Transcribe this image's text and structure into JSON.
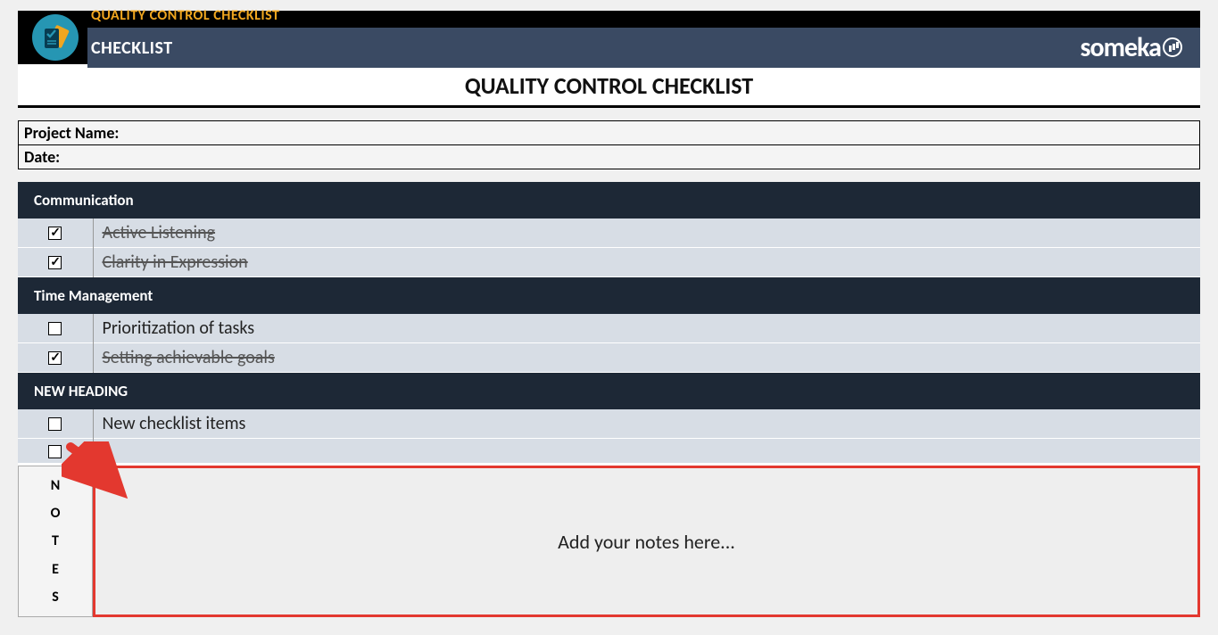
{
  "banner": {
    "title": "QUALITY CONTROL CHECKLIST",
    "subtitle": "CHECKLIST",
    "logo_text": "someka"
  },
  "main_title": "QUALITY CONTROL CHECKLIST",
  "meta": {
    "project_label": "Project Name:",
    "date_label": "Date:"
  },
  "sections": [
    {
      "heading": "Communication",
      "items": [
        {
          "label": "Active Listening",
          "checked": true
        },
        {
          "label": "Clarity in Expression",
          "checked": true
        }
      ]
    },
    {
      "heading": "Time Management",
      "items": [
        {
          "label": "Prioritization of tasks",
          "checked": false
        },
        {
          "label": "Setting achievable goals",
          "checked": true
        }
      ]
    },
    {
      "heading": "NEW HEADING",
      "items": [
        {
          "label": "New checklist items",
          "checked": false
        },
        {
          "label": "",
          "checked": false
        }
      ]
    }
  ],
  "notes": {
    "vertical_label": "NOTES",
    "placeholder": "Add your notes here..."
  }
}
